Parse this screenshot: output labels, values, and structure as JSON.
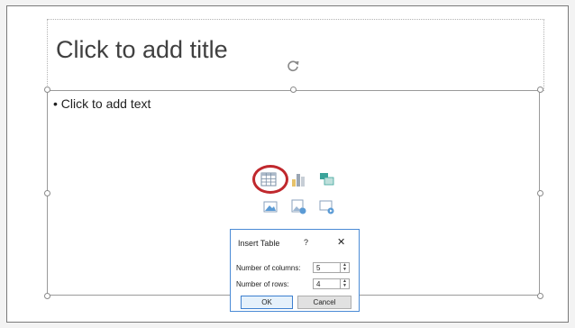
{
  "slide": {
    "title_placeholder": "Click to add title",
    "body_placeholder": "• Click to add text"
  },
  "content_icons": [
    {
      "name": "insert-table-icon"
    },
    {
      "name": "insert-chart-icon"
    },
    {
      "name": "insert-smartart-icon"
    },
    {
      "name": "insert-picture-icon"
    },
    {
      "name": "insert-online-picture-icon"
    },
    {
      "name": "insert-video-icon"
    }
  ],
  "dialog": {
    "title": "Insert Table",
    "help": "?",
    "close": "✕",
    "columns_label": "Number of columns:",
    "columns_value": "5",
    "rows_label": "Number of rows:",
    "rows_value": "4",
    "ok_label": "OK",
    "cancel_label": "Cancel"
  },
  "colors": {
    "highlight": "#c0282d",
    "dialog_border": "#4a8bd6",
    "icon_blue": "#5b9bd5",
    "icon_teal": "#3aa39a"
  }
}
